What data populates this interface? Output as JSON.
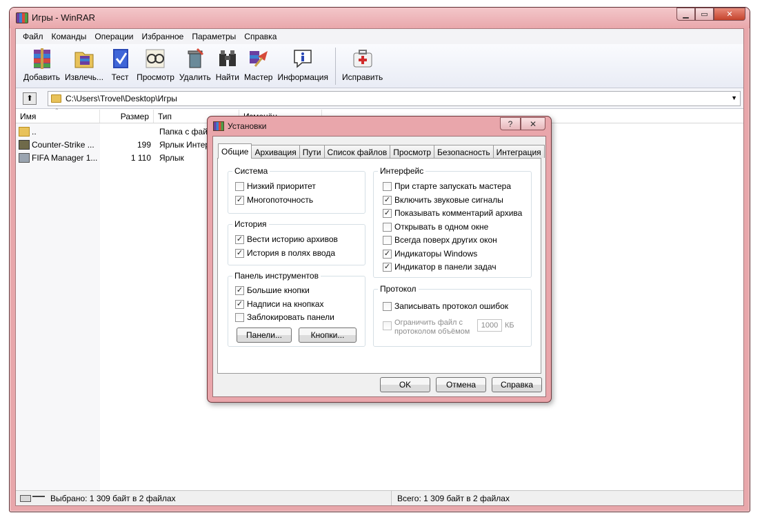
{
  "window": {
    "title": "Игры - WinRAR",
    "min_icon": "minimize-icon",
    "max_icon": "maximize-icon",
    "close_icon": "close-icon"
  },
  "menu": [
    "Файл",
    "Команды",
    "Операции",
    "Избранное",
    "Параметры",
    "Справка"
  ],
  "toolbar": [
    {
      "label": "Добавить",
      "icon": "add-archive-icon"
    },
    {
      "label": "Извлечь...",
      "icon": "extract-icon"
    },
    {
      "label": "Тест",
      "icon": "test-icon"
    },
    {
      "label": "Просмотр",
      "icon": "view-icon"
    },
    {
      "label": "Удалить",
      "icon": "delete-icon"
    },
    {
      "label": "Найти",
      "icon": "find-icon"
    },
    {
      "label": "Мастер",
      "icon": "wizard-icon"
    },
    {
      "label": "Информация",
      "icon": "info-icon"
    },
    {
      "label": "Исправить",
      "icon": "repair-icon"
    }
  ],
  "address": {
    "path": "C:\\Users\\Trovel\\Desktop\\Игры"
  },
  "columns": {
    "name": "Имя",
    "size": "Размер",
    "type": "Тип",
    "modified": "Изменён"
  },
  "files": [
    {
      "name": "..",
      "size": "",
      "type": "Папка с файл"
    },
    {
      "name": "Counter-Strike ...",
      "size": "199",
      "type": "Ярлык Интер"
    },
    {
      "name": "FIFA Manager 1...",
      "size": "1 110",
      "type": "Ярлык"
    }
  ],
  "status": {
    "left": "Выбрано: 1 309 байт в 2 файлах",
    "right": "Всего: 1 309 байт в 2 файлах"
  },
  "dialog": {
    "title": "Установки",
    "help_glyph": "?",
    "close_glyph": "✕",
    "tabs": [
      "Общие",
      "Архивация",
      "Пути",
      "Список файлов",
      "Просмотр",
      "Безопасность",
      "Интеграция"
    ],
    "active_tab": "Общие",
    "groups": {
      "system": {
        "title": "Система",
        "items": [
          {
            "label": "Низкий приоритет",
            "checked": false
          },
          {
            "label": "Многопоточность",
            "checked": true
          }
        ]
      },
      "history": {
        "title": "История",
        "items": [
          {
            "label": "Вести историю архивов",
            "checked": true
          },
          {
            "label": "История в полях ввода",
            "checked": true
          }
        ]
      },
      "toolbar_panel": {
        "title": "Панель инструментов",
        "items": [
          {
            "label": "Большие кнопки",
            "checked": true
          },
          {
            "label": "Надписи на кнопках",
            "checked": true
          },
          {
            "label": "Заблокировать панели",
            "checked": false
          }
        ],
        "buttons": [
          "Панели...",
          "Кнопки..."
        ]
      },
      "interface": {
        "title": "Интерфейс",
        "items": [
          {
            "label": "При старте запускать мастера",
            "checked": false
          },
          {
            "label": "Включить звуковые сигналы",
            "checked": true
          },
          {
            "label": "Показывать комментарий архива",
            "checked": true
          },
          {
            "label": "Открывать в одном окне",
            "checked": false
          },
          {
            "label": "Всегда поверх других окон",
            "checked": false
          },
          {
            "label": "Индикаторы Windows",
            "checked": true
          },
          {
            "label": "Индикатор в панели задач",
            "checked": true
          }
        ]
      },
      "log": {
        "title": "Протокол",
        "items": [
          {
            "label": "Записывать протокол ошибок",
            "checked": false
          },
          {
            "label_line1": "Ограничить файл с",
            "label_line2": "протоколом объёмом",
            "checked": false,
            "disabled": true
          }
        ],
        "limit_value": "1000",
        "limit_unit": "КБ"
      }
    },
    "buttons": {
      "ok": "OK",
      "cancel": "Отмена",
      "help": "Справка"
    }
  }
}
